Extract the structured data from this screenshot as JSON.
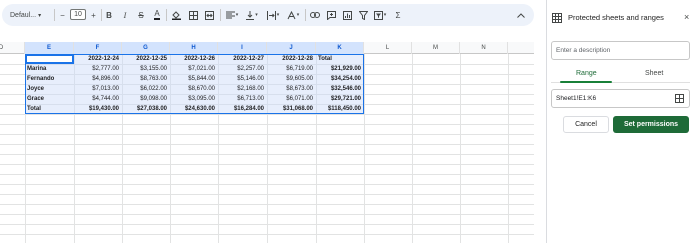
{
  "toolbar": {
    "font_name": "Defaul...",
    "font_size": "10",
    "minus": "−",
    "plus": "+",
    "bold": "B",
    "italic": "I",
    "strike": "S",
    "text_color": "A",
    "sigma": "Σ"
  },
  "grid": {
    "columns": [
      "D",
      "E",
      "F",
      "G",
      "H",
      "I",
      "J",
      "K",
      "L",
      "M",
      "N"
    ],
    "header_row": [
      "",
      "2022-12-24",
      "2022-12-25",
      "2022-12-26",
      "2022-12-27",
      "2022-12-28",
      "Total"
    ],
    "rows": [
      [
        "Marina",
        "$2,777.00",
        "$3,155.00",
        "$7,021.00",
        "$2,257.00",
        "$6,719.00",
        "$21,929.00"
      ],
      [
        "Fernando",
        "$4,896.00",
        "$8,763.00",
        "$5,844.00",
        "$5,146.00",
        "$9,605.00",
        "$34,254.00"
      ],
      [
        "Joyce",
        "$7,013.00",
        "$6,022.00",
        "$8,670.00",
        "$2,168.00",
        "$8,673.00",
        "$32,546.00"
      ],
      [
        "Grace",
        "$4,744.00",
        "$9,098.00",
        "$3,095.00",
        "$6,713.00",
        "$6,071.00",
        "$29,721.00"
      ],
      [
        "Total",
        "$19,430.00",
        "$27,038.00",
        "$24,630.00",
        "$16,284.00",
        "$31,068.00",
        "$118,450.00"
      ]
    ]
  },
  "panel": {
    "title": "Protected sheets and ranges",
    "close": "×",
    "description_placeholder": "Enter a description",
    "tab_range": "Range",
    "tab_sheet": "Sheet",
    "range_value": "Sheet1!E1:K6",
    "cancel_label": "Cancel",
    "set_label": "Set permissions"
  },
  "colors": {
    "accent_green": "#1e6b38",
    "selection_blue": "#1a73e8",
    "toolbar_bg": "#edf2fa"
  }
}
